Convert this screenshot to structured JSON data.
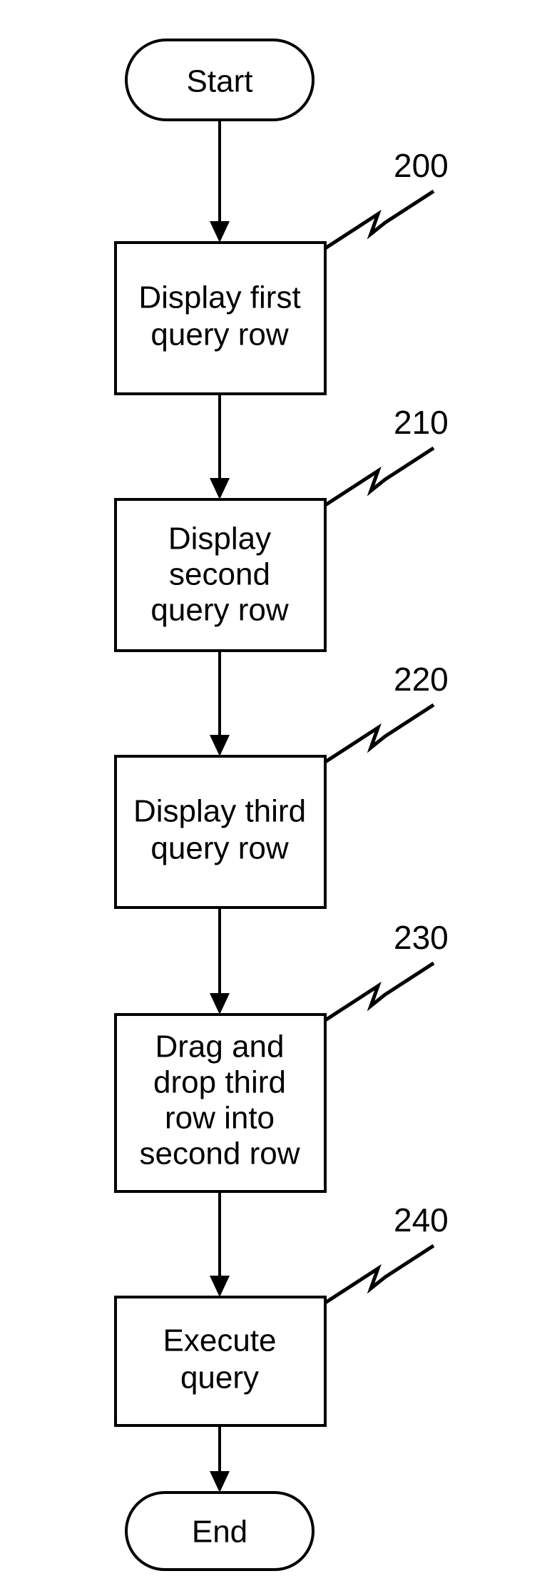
{
  "chart_data": {
    "type": "flowchart",
    "title": "",
    "nodes": [
      {
        "id": "start",
        "kind": "terminator",
        "label": "Start"
      },
      {
        "id": "n200",
        "kind": "process",
        "label": "Display first query row",
        "ref": "200"
      },
      {
        "id": "n210",
        "kind": "process",
        "label": "Display second query row",
        "ref": "210"
      },
      {
        "id": "n220",
        "kind": "process",
        "label": "Display third query row",
        "ref": "220"
      },
      {
        "id": "n230",
        "kind": "process",
        "label": "Drag and drop third row into second row",
        "ref": "230"
      },
      {
        "id": "n240",
        "kind": "process",
        "label": "Execute query",
        "ref": "240"
      },
      {
        "id": "end",
        "kind": "terminator",
        "label": "End"
      }
    ],
    "edges": [
      [
        "start",
        "n200"
      ],
      [
        "n200",
        "n210"
      ],
      [
        "n210",
        "n220"
      ],
      [
        "n220",
        "n230"
      ],
      [
        "n230",
        "n240"
      ],
      [
        "n240",
        "end"
      ]
    ]
  },
  "nodes": {
    "start": {
      "label": "Start"
    },
    "n200": {
      "line1": "Display first",
      "line2": "query row",
      "ref": "200"
    },
    "n210": {
      "line1": "Display",
      "line2": "second",
      "line3": "query row",
      "ref": "210"
    },
    "n220": {
      "line1": "Display third",
      "line2": "query row",
      "ref": "220"
    },
    "n230": {
      "line1": "Drag and",
      "line2": "drop third",
      "line3": "row into",
      "line4": "second row",
      "ref": "230"
    },
    "n240": {
      "line1": "Execute",
      "line2": "query",
      "ref": "240"
    },
    "end": {
      "label": "End"
    }
  }
}
